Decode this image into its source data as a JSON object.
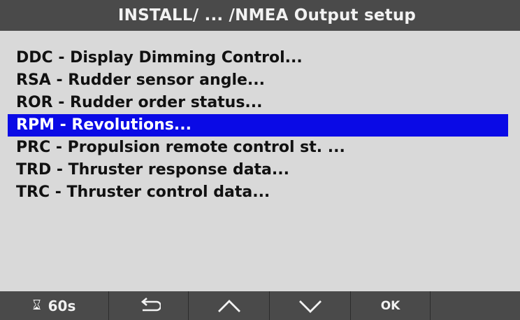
{
  "title": "INSTALL/ ... /NMEA Output setup",
  "menu": {
    "items": [
      {
        "label": "DDC - Display Dimming Control..."
      },
      {
        "label": "RSA - Rudder sensor angle..."
      },
      {
        "label": "ROR - Rudder order status..."
      },
      {
        "label": "RPM - Revolutions...",
        "selected": true
      },
      {
        "label": "PRC - Propulsion remote control st. ..."
      },
      {
        "label": "TRD - Thruster response data..."
      },
      {
        "label": "TRC - Thruster control data..."
      }
    ]
  },
  "softkeys": {
    "timer_icon": "hourglass-icon",
    "timer_label": "60s",
    "back_icon": "back-arrow-icon",
    "up_icon": "chevron-up-icon",
    "down_icon": "chevron-down-icon",
    "ok_label": "OK",
    "blank": ""
  },
  "colors": {
    "background": "#d9d9d9",
    "bar": "#4a4a4a",
    "selection": "#0a0ae6",
    "text": "#111111",
    "bar_text": "#f2f2f2"
  }
}
